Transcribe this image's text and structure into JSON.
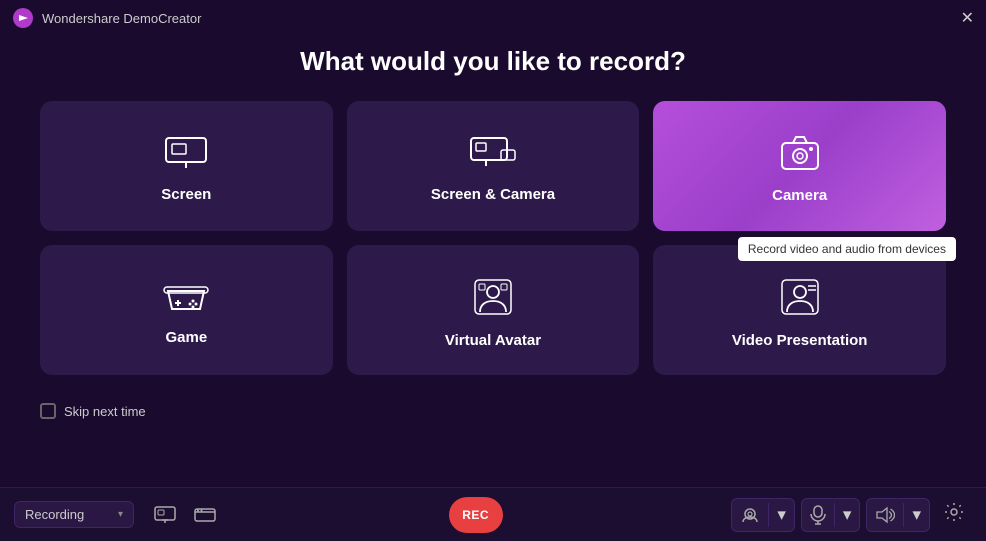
{
  "titleBar": {
    "appName": "Wondershare DemoCreator",
    "closeLabel": "✕"
  },
  "page": {
    "title": "What would you like to record?"
  },
  "cards": [
    {
      "id": "screen",
      "label": "Screen",
      "icon": "🖥",
      "active": false,
      "tooltip": null
    },
    {
      "id": "screen-camera",
      "label": "Screen & Camera",
      "icon": "🖥",
      "active": false,
      "tooltip": null
    },
    {
      "id": "camera",
      "label": "Camera",
      "icon": "📷",
      "active": true,
      "tooltip": "Record video and audio from devices"
    },
    {
      "id": "game",
      "label": "Game",
      "icon": "🎮",
      "active": false,
      "tooltip": null
    },
    {
      "id": "virtual-avatar",
      "label": "Virtual Avatar",
      "icon": "👤",
      "active": false,
      "tooltip": null
    },
    {
      "id": "video-presentation",
      "label": "Video Presentation",
      "icon": "🪪",
      "active": false,
      "tooltip": null
    }
  ],
  "skipCheckbox": {
    "label": "Skip next time",
    "checked": false
  },
  "toolbar": {
    "recordingLabel": "Recording",
    "dropdownArrow": "▾",
    "recButtonLabel": "REC",
    "icons": {
      "screen1": "⬜",
      "screen2": "▭"
    }
  }
}
